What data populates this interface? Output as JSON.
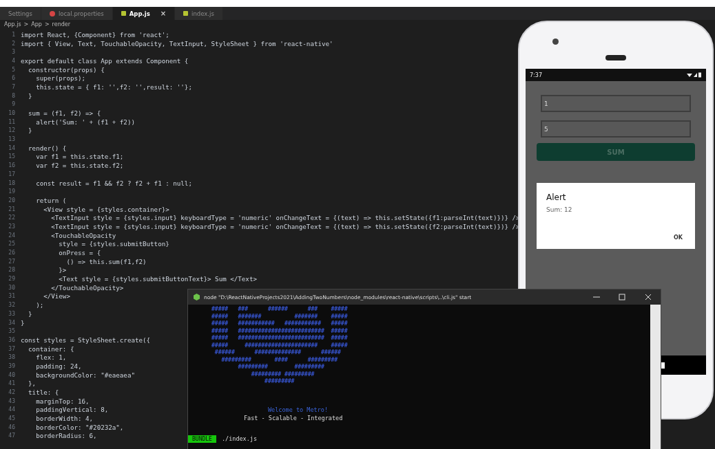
{
  "editor": {
    "tabs": [
      {
        "label": "Settings",
        "kind": "plain",
        "selected": false
      },
      {
        "label": "local.properties",
        "kind": "properties",
        "selected": false
      },
      {
        "label": "App.js",
        "kind": "script",
        "selected": true,
        "close": "×"
      },
      {
        "label": "index.js",
        "kind": "script",
        "selected": false
      }
    ],
    "breadcrumb": [
      "App.js",
      ">",
      "App",
      ">",
      "render"
    ],
    "lines": [
      {
        "number": "1",
        "text": "import React, {Component} from 'react';"
      },
      {
        "number": "2",
        "text": "import { View, Text, TouchableOpacity, TextInput, StyleSheet } from 'react-native'"
      },
      {
        "number": "3"
      },
      {
        "number": "4",
        "text": "export default class App extends Component {"
      },
      {
        "number": "5",
        "text": "  constructor(props) {"
      },
      {
        "number": "6",
        "text": "    super(props);"
      },
      {
        "number": "7",
        "text": "    this.state = { f1: '',f2: '',result: ''};"
      },
      {
        "number": "8",
        "text": "  }"
      },
      {
        "number": "9"
      },
      {
        "number": "10",
        "text": "  sum = (f1, f2) => {"
      },
      {
        "number": "11",
        "text": "    alert('Sum: ' + (f1 + f2))"
      },
      {
        "number": "12",
        "text": "  }"
      },
      {
        "number": "13"
      },
      {
        "number": "14",
        "text": "  render() {"
      },
      {
        "number": "15",
        "text": "    var f1 = this.state.f1;"
      },
      {
        "number": "16",
        "text": "    var f2 = this.state.f2;"
      },
      {
        "number": "17"
      },
      {
        "number": "18",
        "text": "    const result = f1 && f2 ? f2 + f1 : null;"
      },
      {
        "number": "19"
      },
      {
        "number": "20",
        "text": "    return ("
      },
      {
        "number": "21",
        "text": "      <View style = {styles.container}>"
      },
      {
        "number": "22",
        "text": "        <TextInput style = {styles.input} keyboardType = 'numeric' onChangeText = {(text) => this.setState({f1:parseInt(text)})} />"
      },
      {
        "number": "23",
        "text": "        <TextInput style = {styles.input} keyboardType = 'numeric' onChangeText = {(text) => this.setState({f2:parseInt(text)})} />"
      },
      {
        "number": "24",
        "text": "        <TouchableOpacity"
      },
      {
        "number": "25",
        "text": "          style = {styles.submitButton}"
      },
      {
        "number": "26",
        "text": "          onPress = {"
      },
      {
        "number": "27",
        "text": "            () => this.sum(f1,f2)"
      },
      {
        "number": "28",
        "text": "          }>"
      },
      {
        "number": "29",
        "text": "          <Text style = {styles.submitButtonText}> Sum </Text>"
      },
      {
        "number": "30",
        "text": "        </TouchableOpacity>"
      },
      {
        "number": "31",
        "text": "      </View>"
      },
      {
        "number": "32",
        "text": "    );"
      },
      {
        "number": "33",
        "text": "  }"
      },
      {
        "number": "34",
        "text": "}"
      },
      {
        "number": "35"
      },
      {
        "number": "36",
        "text": "const styles = StyleSheet.create({"
      },
      {
        "number": "37",
        "text": "  container: {"
      },
      {
        "number": "38",
        "text": "    flex: 1,"
      },
      {
        "number": "39",
        "text": "    padding: 24,"
      },
      {
        "number": "40",
        "text": "    backgroundColor: \"#eaeaea\""
      },
      {
        "number": "41",
        "text": "  },"
      },
      {
        "number": "42",
        "text": "  title: {"
      },
      {
        "number": "43",
        "text": "    marginTop: 16,"
      },
      {
        "number": "44",
        "text": "    paddingVertical: 8,"
      },
      {
        "number": "45",
        "text": "    borderWidth: 4,"
      },
      {
        "number": "46",
        "text": "    borderColor: \"#20232a\","
      },
      {
        "number": "47",
        "text": "    borderRadius: 6,"
      }
    ]
  },
  "phone": {
    "time": "7:37",
    "fields": [
      {
        "value": "1"
      },
      {
        "value": "5"
      }
    ],
    "button": "SUM",
    "alert": {
      "title": "Alert",
      "message": "Sum: 12",
      "action": "OK"
    }
  },
  "terminal": {
    "title": "node \"D:\\ReactNativeProjects2021\\AddingTwoNumbers\\node_modules\\react-native\\scripts\\..\\cli.js\" start",
    "art": [
      "#####   ###      ######      ###    #####",
      "#####   #######          #######    #####",
      "#####   ###########   ###########   #####",
      "#####   ##########################  #####",
      "#####   ##########################  #####",
      "#####     ######################    #####",
      " ######      ##############      ######",
      "   #########       ####      #########",
      "        #########        #########",
      "            ######### #########",
      "                #########"
    ],
    "welcome": "Welcome to Metro!",
    "tagline": "Fast - Scalable - Integrated",
    "badge": "BUNDLE",
    "bundle_path": "./index.js"
  }
}
